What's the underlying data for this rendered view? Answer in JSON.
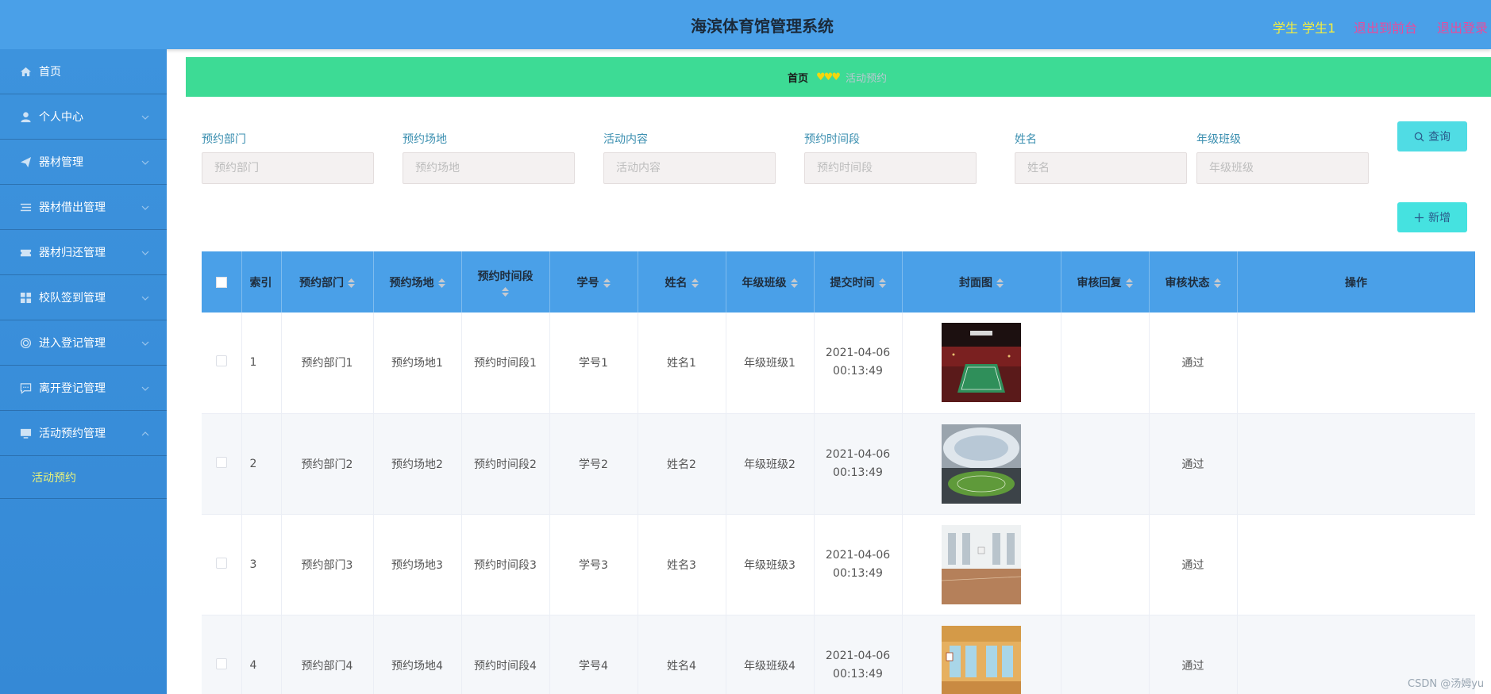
{
  "header": {
    "title": "海滨体育馆管理系统",
    "user": "学生 学生1",
    "front_link": "退出到前台",
    "logout_link": "退出登录"
  },
  "sidebar": {
    "items": [
      {
        "label": "首页",
        "icon": "home-icon",
        "arrow": false
      },
      {
        "label": "个人中心",
        "icon": "user-icon",
        "arrow": true
      },
      {
        "label": "器材管理",
        "icon": "paper-plane-icon",
        "arrow": true
      },
      {
        "label": "器材借出管理",
        "icon": "list-icon",
        "arrow": true
      },
      {
        "label": "器材归还管理",
        "icon": "ticket-icon",
        "arrow": true
      },
      {
        "label": "校队签到管理",
        "icon": "grid-icon",
        "arrow": true
      },
      {
        "label": "进入登记管理",
        "icon": "circle-icon",
        "arrow": true
      },
      {
        "label": "离开登记管理",
        "icon": "message-icon",
        "arrow": true
      },
      {
        "label": "活动预约管理",
        "icon": "monitor-icon",
        "arrow": true,
        "expanded": true
      }
    ],
    "submenu": {
      "label": "活动预约"
    }
  },
  "breadcrumb": {
    "home": "首页",
    "separator": "♥♥♥",
    "current": "活动预约"
  },
  "search": {
    "fields": [
      {
        "label": "预约部门",
        "placeholder": "预约部门"
      },
      {
        "label": "预约场地",
        "placeholder": "预约场地"
      },
      {
        "label": "活动内容",
        "placeholder": "活动内容"
      },
      {
        "label": "预约时间段",
        "placeholder": "预约时间段"
      },
      {
        "label": "姓名",
        "placeholder": "姓名"
      },
      {
        "label": "年级班级",
        "placeholder": "年级班级"
      }
    ],
    "search_button": "查询",
    "add_button": "新增"
  },
  "table": {
    "headers": {
      "index": "索引",
      "dept": "预约部门",
      "venue": "预约场地",
      "timeslot": "预约时间段",
      "student_no": "学号",
      "name": "姓名",
      "class": "年级班级",
      "submit_time": "提交时间",
      "cover": "封面图",
      "reply": "审核回复",
      "status": "审核状态",
      "actions": "操作"
    },
    "rows": [
      {
        "index": "1",
        "dept": "预约部门1",
        "venue": "预约场地1",
        "timeslot": "预约时间段1",
        "student_no": "学号1",
        "name": "姓名1",
        "class": "年级班级1",
        "date": "2021-04-06",
        "time": "00:13:49",
        "reply": "",
        "status": "通过",
        "cover": "arena-image"
      },
      {
        "index": "2",
        "dept": "预约部门2",
        "venue": "预约场地2",
        "timeslot": "预约时间段2",
        "student_no": "学号2",
        "name": "姓名2",
        "class": "年级班级2",
        "date": "2021-04-06",
        "time": "00:13:49",
        "reply": "",
        "status": "通过",
        "cover": "stadium-image"
      },
      {
        "index": "3",
        "dept": "预约部门3",
        "venue": "预约场地3",
        "timeslot": "预约时间段3",
        "student_no": "学号3",
        "name": "姓名3",
        "class": "年级班级3",
        "date": "2021-04-06",
        "time": "00:13:49",
        "reply": "",
        "status": "通过",
        "cover": "gym-image"
      },
      {
        "index": "4",
        "dept": "预约部门4",
        "venue": "预约场地4",
        "timeslot": "预约时间段4",
        "student_no": "学号4",
        "name": "姓名4",
        "class": "年级班级4",
        "date": "2021-04-06",
        "time": "00:13:49",
        "reply": "",
        "status": "通过",
        "cover": "court-image"
      }
    ]
  },
  "watermark": "CSDN @汤姆yu",
  "colors": {
    "header": "#4aa0e8",
    "sidebar": "#3d93dd",
    "breadcrumb": "#3ddb95",
    "search_button": "#50dce4",
    "add_button": "#45e2e0",
    "user_text": "#f6ef3d",
    "link_text": "#e84b9c"
  }
}
